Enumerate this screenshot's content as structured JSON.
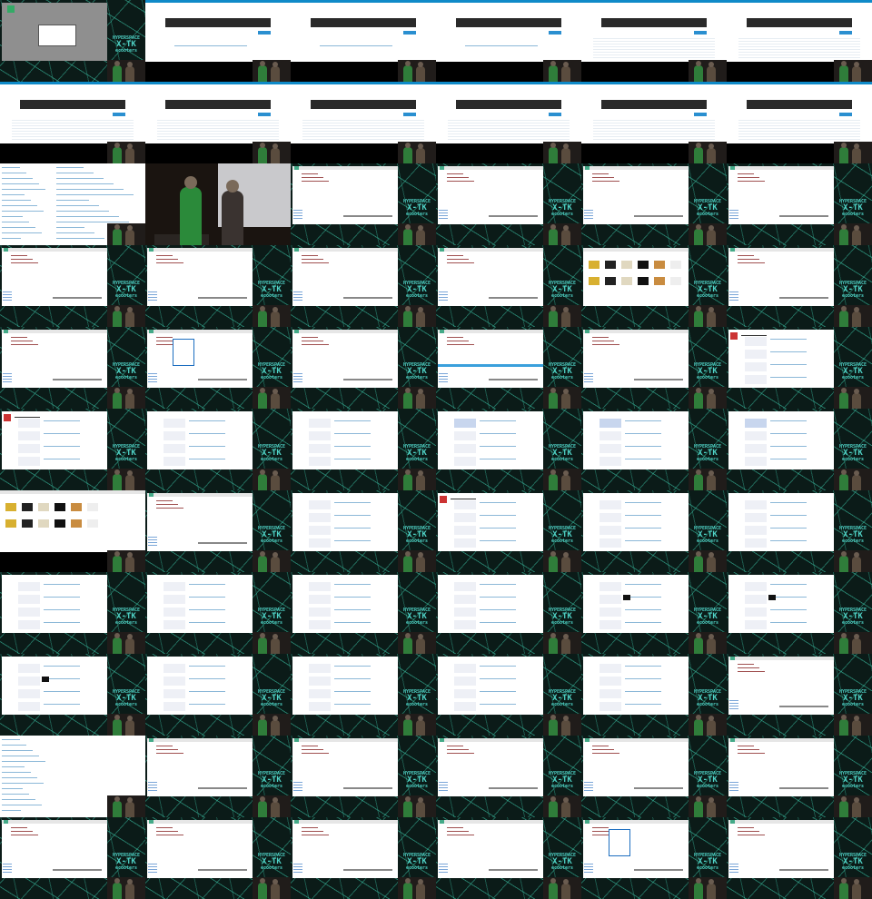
{
  "logo": {
    "line1": "HYPERSPACE",
    "line2": "X-TK",
    "line3": "ecooters"
  },
  "grid": {
    "columns": 6,
    "rows": 11
  },
  "frames": [
    {
      "kind": "dialog"
    },
    {
      "kind": "form-code"
    },
    {
      "kind": "code-wide"
    },
    {
      "kind": "code-wide"
    },
    {
      "kind": "code-table"
    },
    {
      "kind": "code-table"
    },
    {
      "kind": "code-table"
    },
    {
      "kind": "code-table"
    },
    {
      "kind": "code-table"
    },
    {
      "kind": "code-table"
    },
    {
      "kind": "code-table"
    },
    {
      "kind": "code-table"
    },
    {
      "kind": "link-list"
    },
    {
      "kind": "photo"
    },
    {
      "kind": "editor"
    },
    {
      "kind": "editor"
    },
    {
      "kind": "editor"
    },
    {
      "kind": "editor"
    },
    {
      "kind": "editor"
    },
    {
      "kind": "list"
    },
    {
      "kind": "list"
    },
    {
      "kind": "list"
    },
    {
      "kind": "image-grid"
    },
    {
      "kind": "editor"
    },
    {
      "kind": "editor"
    },
    {
      "kind": "editor-menu"
    },
    {
      "kind": "editor"
    },
    {
      "kind": "editor-bar"
    },
    {
      "kind": "editor"
    },
    {
      "kind": "wiki"
    },
    {
      "kind": "wiki"
    },
    {
      "kind": "form"
    },
    {
      "kind": "form"
    },
    {
      "kind": "form-highlight"
    },
    {
      "kind": "form-highlight"
    },
    {
      "kind": "form-highlight"
    },
    {
      "kind": "image-browser"
    },
    {
      "kind": "blank"
    },
    {
      "kind": "form"
    },
    {
      "kind": "wiki-small"
    },
    {
      "kind": "form"
    },
    {
      "kind": "form"
    },
    {
      "kind": "form"
    },
    {
      "kind": "form"
    },
    {
      "kind": "form"
    },
    {
      "kind": "form"
    },
    {
      "kind": "form-cat"
    },
    {
      "kind": "form-cat"
    },
    {
      "kind": "form-cat"
    },
    {
      "kind": "form"
    },
    {
      "kind": "form"
    },
    {
      "kind": "form"
    },
    {
      "kind": "form"
    },
    {
      "kind": "editor-top"
    },
    {
      "kind": "list-white"
    },
    {
      "kind": "editor"
    },
    {
      "kind": "editor"
    },
    {
      "kind": "editor"
    },
    {
      "kind": "editor"
    },
    {
      "kind": "editor"
    },
    {
      "kind": "editor"
    },
    {
      "kind": "editor"
    },
    {
      "kind": "editor"
    },
    {
      "kind": "editor"
    },
    {
      "kind": "editor-menu"
    },
    {
      "kind": "editor"
    }
  ]
}
